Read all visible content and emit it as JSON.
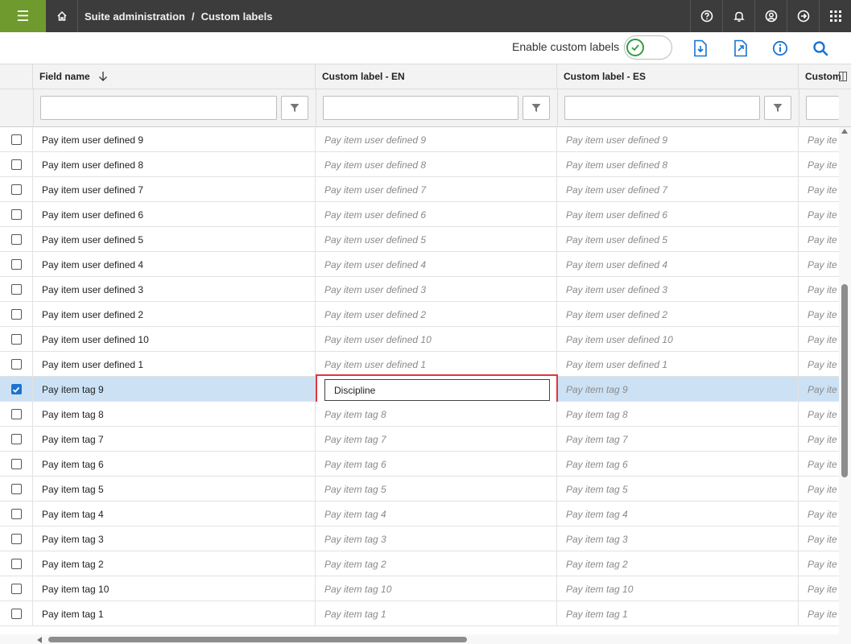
{
  "breadcrumb": {
    "parent": "Suite administration",
    "separator": "/",
    "current": "Custom labels"
  },
  "toolbar": {
    "toggle_label": "Enable custom labels",
    "toggle_on": true
  },
  "columns": {
    "field_name": "Field name",
    "custom_en": "Custom label - EN",
    "custom_es": "Custom label - ES",
    "custom_next": "Custom"
  },
  "rows": [
    {
      "name": "Pay item user defined 9",
      "en": "Pay item user defined 9",
      "es": "Pay item user defined 9",
      "next": "Pay ite"
    },
    {
      "name": "Pay item user defined 8",
      "en": "Pay item user defined 8",
      "es": "Pay item user defined 8",
      "next": "Pay ite"
    },
    {
      "name": "Pay item user defined 7",
      "en": "Pay item user defined 7",
      "es": "Pay item user defined 7",
      "next": "Pay ite"
    },
    {
      "name": "Pay item user defined 6",
      "en": "Pay item user defined 6",
      "es": "Pay item user defined 6",
      "next": "Pay ite"
    },
    {
      "name": "Pay item user defined 5",
      "en": "Pay item user defined 5",
      "es": "Pay item user defined 5",
      "next": "Pay ite"
    },
    {
      "name": "Pay item user defined 4",
      "en": "Pay item user defined 4",
      "es": "Pay item user defined 4",
      "next": "Pay ite"
    },
    {
      "name": "Pay item user defined 3",
      "en": "Pay item user defined 3",
      "es": "Pay item user defined 3",
      "next": "Pay ite"
    },
    {
      "name": "Pay item user defined 2",
      "en": "Pay item user defined 2",
      "es": "Pay item user defined 2",
      "next": "Pay ite"
    },
    {
      "name": "Pay item user defined 10",
      "en": "Pay item user defined 10",
      "es": "Pay item user defined 10",
      "next": "Pay ite"
    },
    {
      "name": "Pay item user defined 1",
      "en": "Pay item user defined 1",
      "es": "Pay item user defined 1",
      "next": "Pay ite"
    },
    {
      "name": "Pay item tag 9",
      "en": "Discipline",
      "es": "Pay item tag 9",
      "next": "Pay ite",
      "selected": true,
      "editing": true
    },
    {
      "name": "Pay item tag 8",
      "en": "Pay item tag 8",
      "es": "Pay item tag 8",
      "next": "Pay ite"
    },
    {
      "name": "Pay item tag 7",
      "en": "Pay item tag 7",
      "es": "Pay item tag 7",
      "next": "Pay ite"
    },
    {
      "name": "Pay item tag 6",
      "en": "Pay item tag 6",
      "es": "Pay item tag 6",
      "next": "Pay ite"
    },
    {
      "name": "Pay item tag 5",
      "en": "Pay item tag 5",
      "es": "Pay item tag 5",
      "next": "Pay ite"
    },
    {
      "name": "Pay item tag 4",
      "en": "Pay item tag 4",
      "es": "Pay item tag 4",
      "next": "Pay ite"
    },
    {
      "name": "Pay item tag 3",
      "en": "Pay item tag 3",
      "es": "Pay item tag 3",
      "next": "Pay ite"
    },
    {
      "name": "Pay item tag 2",
      "en": "Pay item tag 2",
      "es": "Pay item tag 2",
      "next": "Pay ite"
    },
    {
      "name": "Pay item tag 10",
      "en": "Pay item tag 10",
      "es": "Pay item tag 10",
      "next": "Pay ite"
    },
    {
      "name": "Pay item tag 1",
      "en": "Pay item tag 1",
      "es": "Pay item tag 1",
      "next": "Pay ite"
    }
  ],
  "icons": {
    "menu": "hamburger-icon",
    "home": "home-icon",
    "help": "help-icon",
    "bell": "bell-icon",
    "user": "user-icon",
    "logout": "logout-icon",
    "apps": "apps-grid-icon",
    "import": "import-icon",
    "export": "export-icon",
    "info": "info-icon",
    "search": "search-icon"
  },
  "colors": {
    "accent": "#1a73d0",
    "menu_green": "#6f9a2d",
    "topbar": "#3c3c3c",
    "toggle_green": "#2e9e3a",
    "highlight_red": "#e0353e",
    "selected_row": "#cde1f4"
  }
}
